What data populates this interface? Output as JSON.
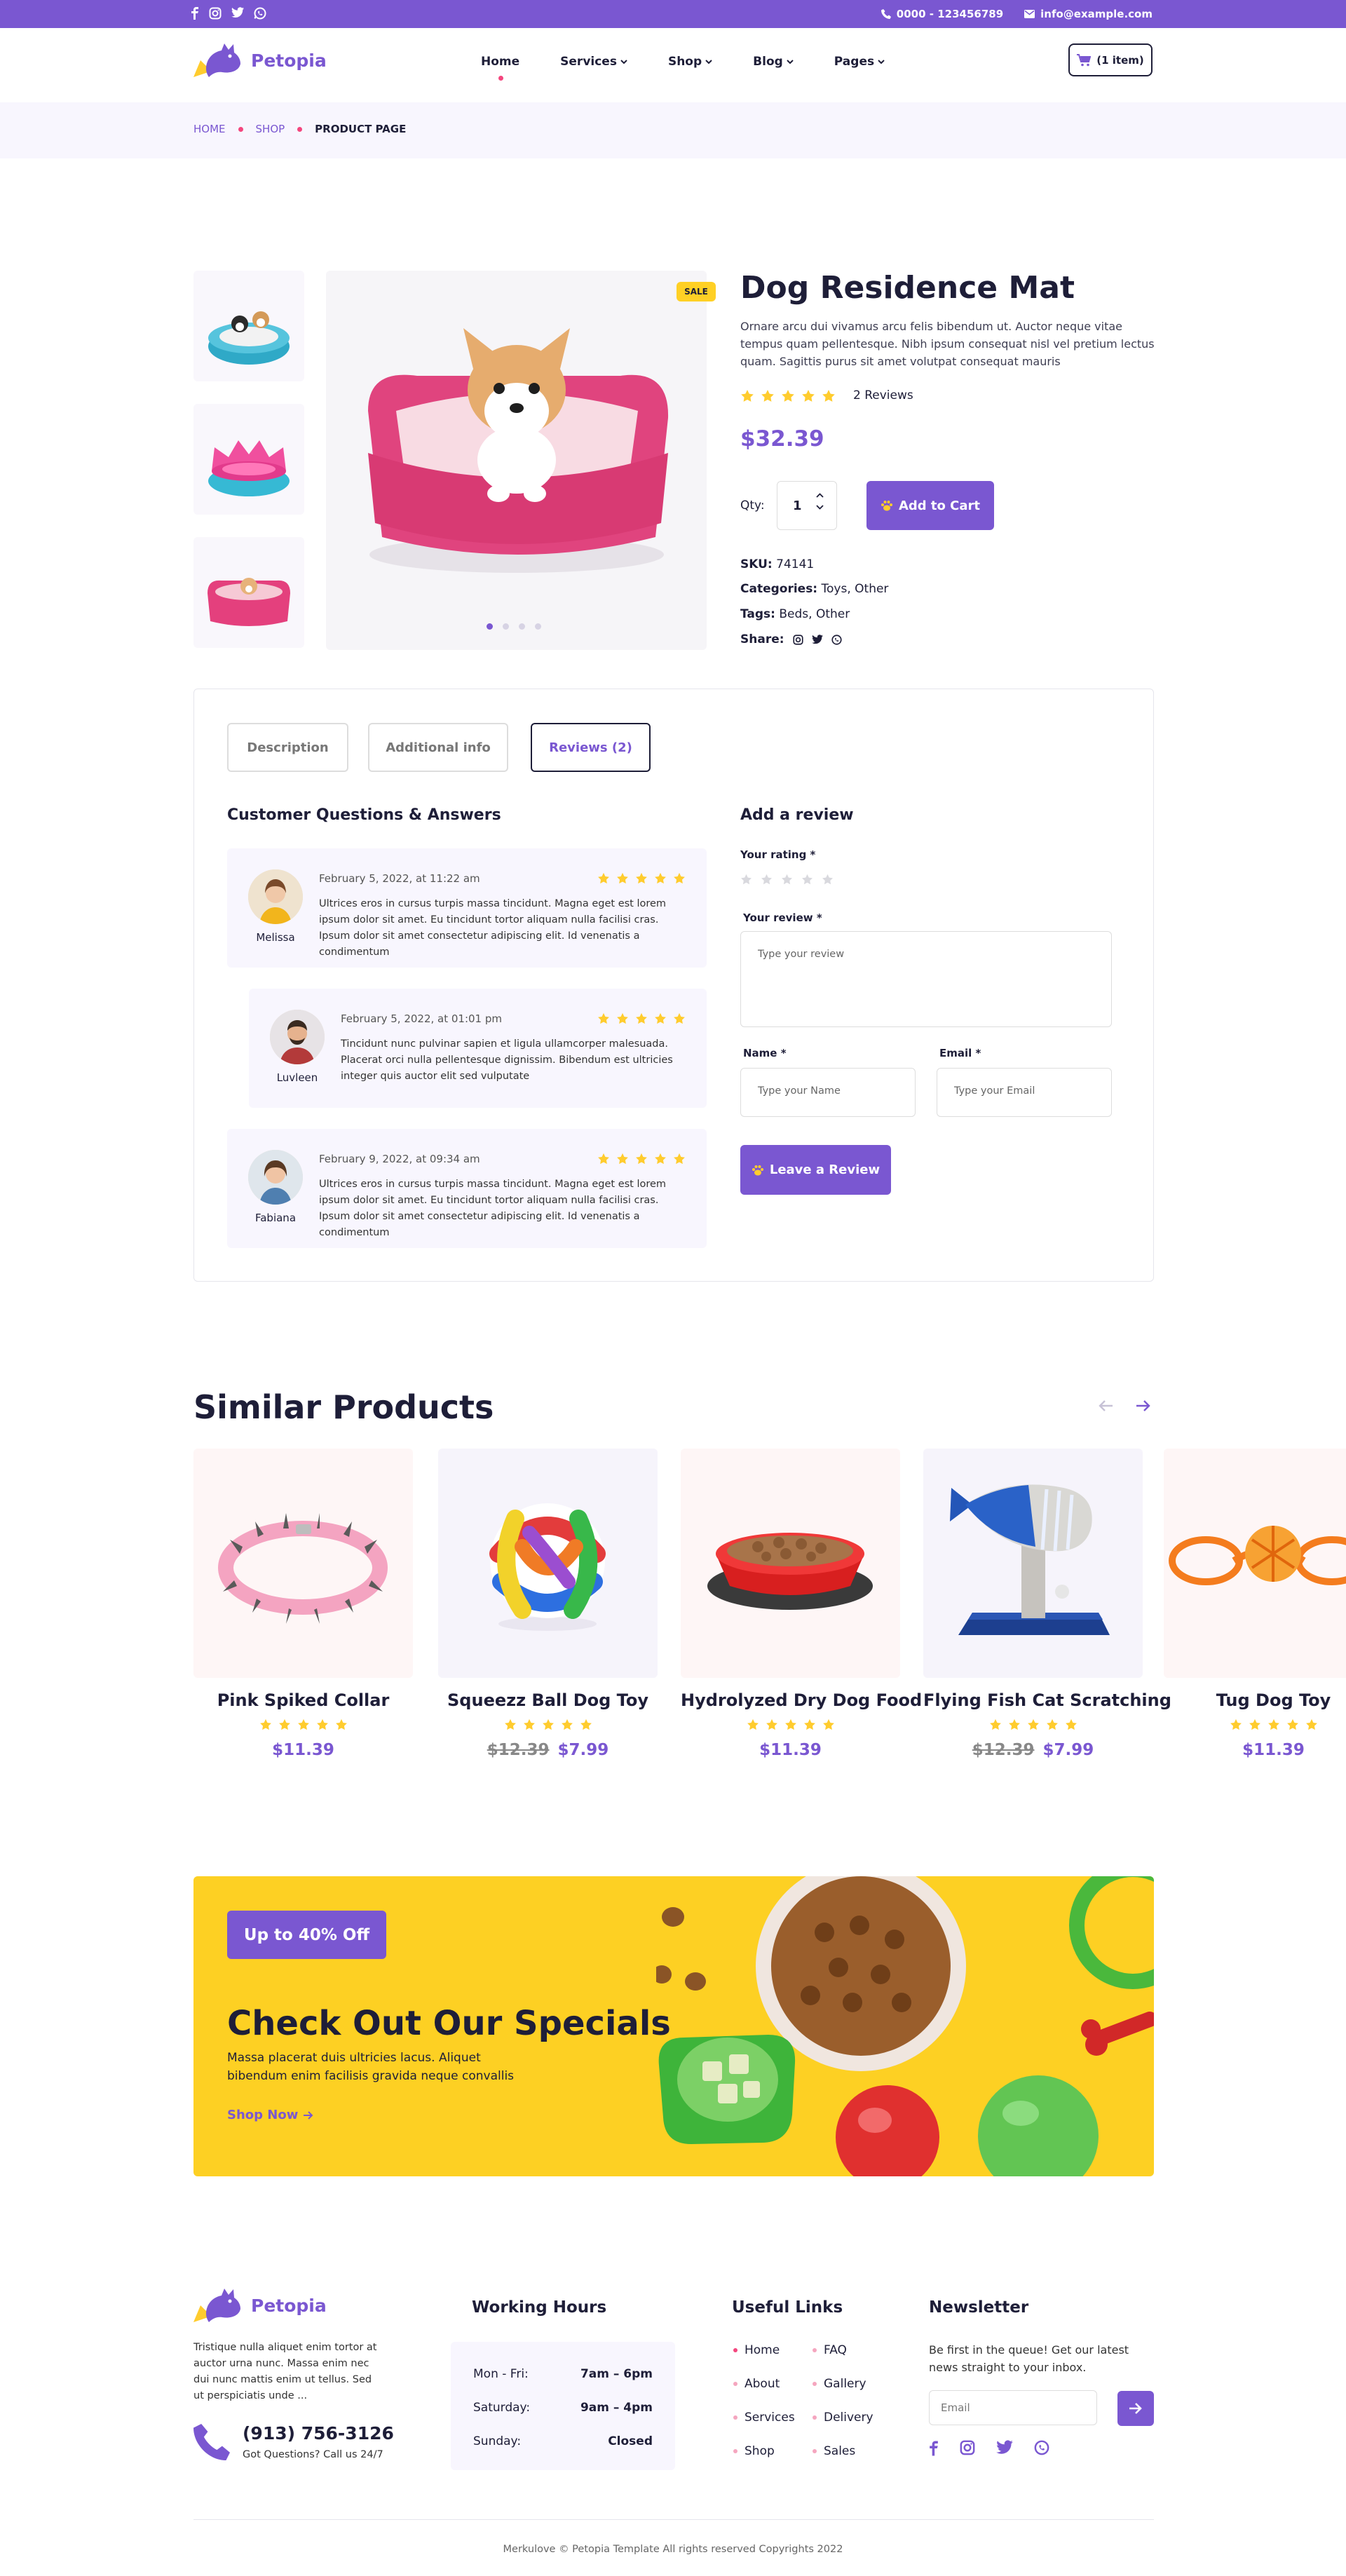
{
  "topbar": {
    "social_icons": [
      "facebook-icon",
      "instagram-icon",
      "twitter-icon",
      "whatsapp-icon"
    ],
    "phone": "0000 - 123456789",
    "email": "info@example.com"
  },
  "header": {
    "brand": "Petopia",
    "nav": [
      {
        "label": "Home",
        "active": true,
        "dropdown": false
      },
      {
        "label": "Services",
        "dropdown": true
      },
      {
        "label": "Shop",
        "dropdown": true
      },
      {
        "label": "Blog",
        "dropdown": true
      },
      {
        "label": "Pages",
        "dropdown": true
      }
    ],
    "cart_label": "(1 item)"
  },
  "breadcrumb": [
    "HOME",
    "SHOP",
    "PRODUCT PAGE"
  ],
  "product": {
    "badge": "SALE",
    "title": "Dog Residence Mat",
    "description": "Ornare arcu dui vivamus arcu felis bibendum ut. Auctor neque vitae tempus quam pellentesque. Nibh ipsum consequat nisl vel pretium lectus quam. Sagittis purus sit amet volutpat consequat mauris",
    "rating": 5,
    "reviews_label": "2 Reviews",
    "price": "$32.39",
    "qty_label": "Qty:",
    "qty_value": "1",
    "add_to_cart": "Add to Cart",
    "sku_label": "SKU:",
    "sku": "74141",
    "categories_label": "Categories:",
    "categories": "Toys, Other",
    "tags_label": "Tags:",
    "tags": "Beds, Other",
    "share_label": "Share:",
    "share_icons": [
      "instagram-icon",
      "twitter-icon",
      "whatsapp-icon"
    ],
    "gallery_dots": 4,
    "gallery_active": 1
  },
  "tabs": [
    {
      "label": "Description",
      "active": false
    },
    {
      "label": "Additional info",
      "active": false
    },
    {
      "label": "Reviews (2)",
      "active": true
    }
  ],
  "qa": {
    "heading": "Customer Questions & Answers",
    "reviews": [
      {
        "name": "Melissa",
        "date": "February 5, 2022, at 11:22 am",
        "rating": 5,
        "text": "Ultrices eros in cursus turpis massa tincidunt. Magna eget est lorem ipsum dolor sit amet. Eu tincidunt tortor aliquam nulla facilisi cras. Ipsum dolor sit amet consectetur adipiscing elit. Id venenatis a condimentum"
      },
      {
        "name": "Luvleen",
        "date": "February 5, 2022, at 01:01 pm",
        "rating": 5,
        "text": "Tincidunt nunc pulvinar sapien et ligula ullamcorper malesuada. Placerat orci nulla pellentesque dignissim. Bibendum est ultricies integer quis auctor elit sed vulputate"
      },
      {
        "name": "Fabiana",
        "date": "February 9, 2022, at 09:34 am",
        "rating": 5,
        "text": "Ultrices eros in cursus turpis massa tincidunt. Magna eget est lorem ipsum dolor sit amet. Eu tincidunt tortor aliquam nulla facilisi cras. Ipsum dolor sit amet consectetur adipiscing elit. Id venenatis a condimentum"
      }
    ]
  },
  "review_form": {
    "heading": "Add a review",
    "rating_label": "Your rating *",
    "review_label": "Your review *",
    "review_placeholder": "Type your review",
    "name_label": "Name *",
    "name_placeholder": "Type your Name",
    "email_label": "Email *",
    "email_placeholder": "Type your Email",
    "submit": "Leave a Review"
  },
  "similar": {
    "heading": "Similar Products",
    "products": [
      {
        "title": "Pink Spiked Collar",
        "price": "$11.39",
        "old_price": "",
        "rating": 5
      },
      {
        "title": "Squeezz Ball Dog Toy",
        "price": "$7.99",
        "old_price": "$12.39",
        "rating": 5
      },
      {
        "title": "Hydrolyzed Dry Dog Food",
        "price": "$11.39",
        "old_price": "",
        "rating": 5
      },
      {
        "title": "Flying Fish Cat Scratching",
        "price": "$7.99",
        "old_price": "$12.39",
        "rating": 5
      },
      {
        "title": "Tug Dog Toy",
        "price": "$11.39",
        "old_price": "",
        "rating": 5
      }
    ]
  },
  "promo": {
    "badge": "Up to 40% Off",
    "title": "Check Out Our Specials",
    "text": "Massa placerat duis ultricies lacus. Aliquet bibendum enim facilisis gravida neque convallis",
    "link": "Shop Now"
  },
  "footer": {
    "brand": "Petopia",
    "about": "Tristique nulla aliquet enim tortor at auctor urna nunc. Massa enim nec dui nunc mattis enim ut tellus. Sed ut perspiciatis unde ...",
    "phone": "(913) 756-3126",
    "phone_sub": "Got Questions? Call us 24/7",
    "hours_heading": "Working Hours",
    "hours": [
      {
        "day": "Mon - Fri:",
        "time": "7am – 6pm"
      },
      {
        "day": "Saturday:",
        "time": "9am – 4pm"
      },
      {
        "day": "Sunday:",
        "time": "Closed"
      }
    ],
    "links_heading": "Useful Links",
    "links_col1": [
      "Home",
      "About",
      "Services",
      "Shop"
    ],
    "links_col2": [
      "FAQ",
      "Gallery",
      "Delivery",
      "Sales"
    ],
    "newsletter_heading": "Newsletter",
    "newsletter_text": "Be first in the queue! Get our latest news straight to your inbox.",
    "newsletter_placeholder": "Email",
    "social_icons": [
      "facebook-icon",
      "instagram-icon",
      "twitter-icon",
      "whatsapp-icon"
    ],
    "copyright": "Merkulove © Petopia Template All rights reserved Copyrights 2022"
  },
  "colors": {
    "brand": "#7a57d1",
    "accent": "#f4467e",
    "star": "#ffcc2e",
    "promo_bg": "#fdd023"
  }
}
